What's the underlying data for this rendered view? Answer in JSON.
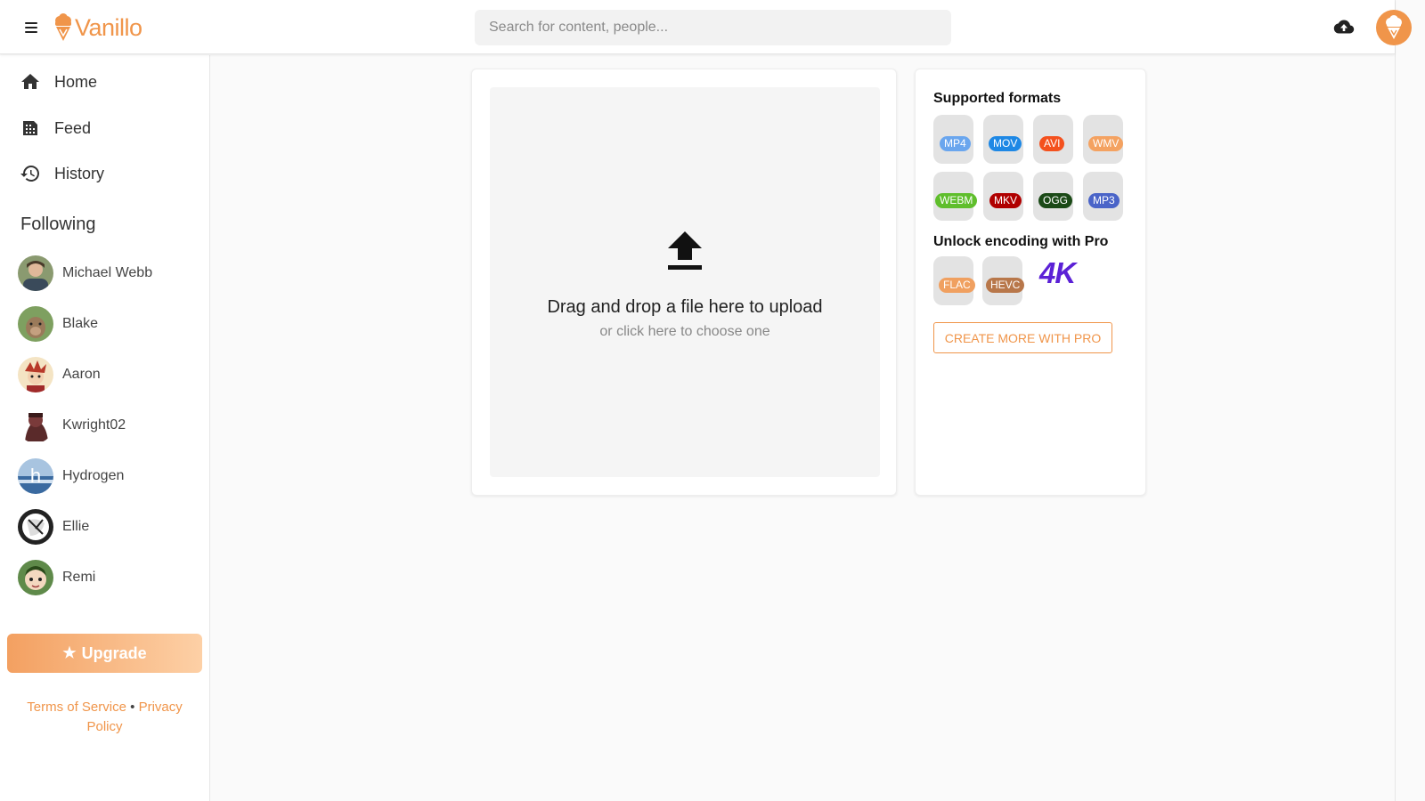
{
  "header": {
    "brand": "Vanillo",
    "search_placeholder": "Search for content, people..."
  },
  "sidebar": {
    "nav": [
      {
        "label": "Home",
        "icon": "home-icon"
      },
      {
        "label": "Feed",
        "icon": "feed-icon"
      },
      {
        "label": "History",
        "icon": "history-icon"
      }
    ],
    "following_title": "Following",
    "following": [
      {
        "name": "Michael Webb",
        "color": "#6b7a5a"
      },
      {
        "name": "Blake",
        "color": "#7ea060"
      },
      {
        "name": "Aaron",
        "color": "#e8c89a"
      },
      {
        "name": "Kwright02",
        "color": "#5a2a2a"
      },
      {
        "name": "Hydrogen",
        "color": "#5a8ac0",
        "initial": "h"
      },
      {
        "name": "Ellie",
        "color": "#2a2a2a"
      },
      {
        "name": "Remi",
        "color": "#5f8a4a"
      }
    ],
    "upgrade_label": "Upgrade",
    "footer": {
      "terms": "Terms of Service",
      "separator": "•",
      "privacy": "Privacy Policy"
    }
  },
  "upload": {
    "title": "Drag and drop a file here to upload",
    "subtitle": "or click here to choose one"
  },
  "formats": {
    "title": "Supported formats",
    "items": [
      {
        "label": "MP4",
        "color": "#6aa6ee"
      },
      {
        "label": "MOV",
        "color": "#1e88e5"
      },
      {
        "label": "AVI",
        "color": "#f4511e"
      },
      {
        "label": "WMV",
        "color": "#f4a261"
      },
      {
        "label": "WEBM",
        "color": "#5fbe2c"
      },
      {
        "label": "MKV",
        "color": "#b00000"
      },
      {
        "label": "OGG",
        "color": "#1b4a17"
      },
      {
        "label": "MP3",
        "color": "#4a64c8"
      }
    ],
    "pro_title": "Unlock encoding with Pro",
    "pro_items": [
      {
        "label": "FLAC",
        "color": "#f0a060"
      },
      {
        "label": "HEVC",
        "color": "#b8774a"
      }
    ],
    "pro_badge": "4K",
    "pro_button": "CREATE MORE WITH PRO"
  },
  "colors": {
    "accent": "#f0954a",
    "pro_purple": "#5b21d6"
  }
}
